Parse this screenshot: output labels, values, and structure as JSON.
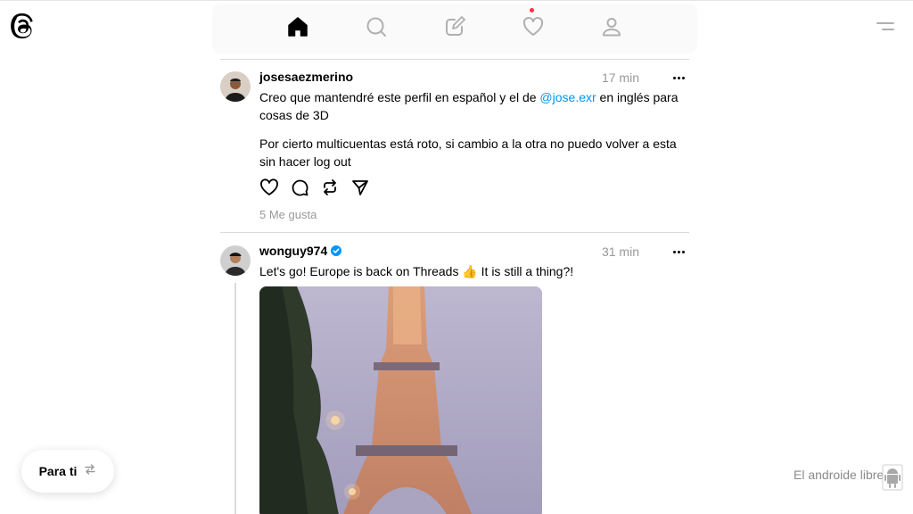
{
  "app": {
    "logo_icon": "threads-logo-icon"
  },
  "nav": {
    "items": [
      {
        "icon": "home-icon",
        "active": true
      },
      {
        "icon": "search-icon",
        "active": false
      },
      {
        "icon": "compose-icon",
        "active": false
      },
      {
        "icon": "heart-icon",
        "active": false,
        "notification_dot": true
      },
      {
        "icon": "profile-icon",
        "active": false
      }
    ],
    "menu_icon": "menu-icon"
  },
  "feed": {
    "posts": [
      {
        "username": "josesaezmerino",
        "time": "17 min",
        "verified": false,
        "text_1a": "Creo que mantendré este perfil en español y el de ",
        "mention": "@jose.exr",
        "text_1b": " en inglés para cosas de 3D",
        "text_2": "Por cierto multicuentas está roto, si cambio a la otra no puedo volver a esta sin hacer log out",
        "likes": "5 Me gusta"
      },
      {
        "username": "wonguy974",
        "time": "31 min",
        "verified": true,
        "text": "Let's go! Europe is back on Threads 👍 It is still a thing?!",
        "image": "eiffel-tower-photo"
      }
    ]
  },
  "feed_switcher": {
    "label": "Para ti",
    "icon": "switch-arrows-icon"
  },
  "watermark": {
    "text": "El androide libre"
  },
  "colors": {
    "accent": "#0095f6",
    "notification": "#ff3040",
    "muted": "#999999",
    "divider": "#dbdbdb"
  }
}
